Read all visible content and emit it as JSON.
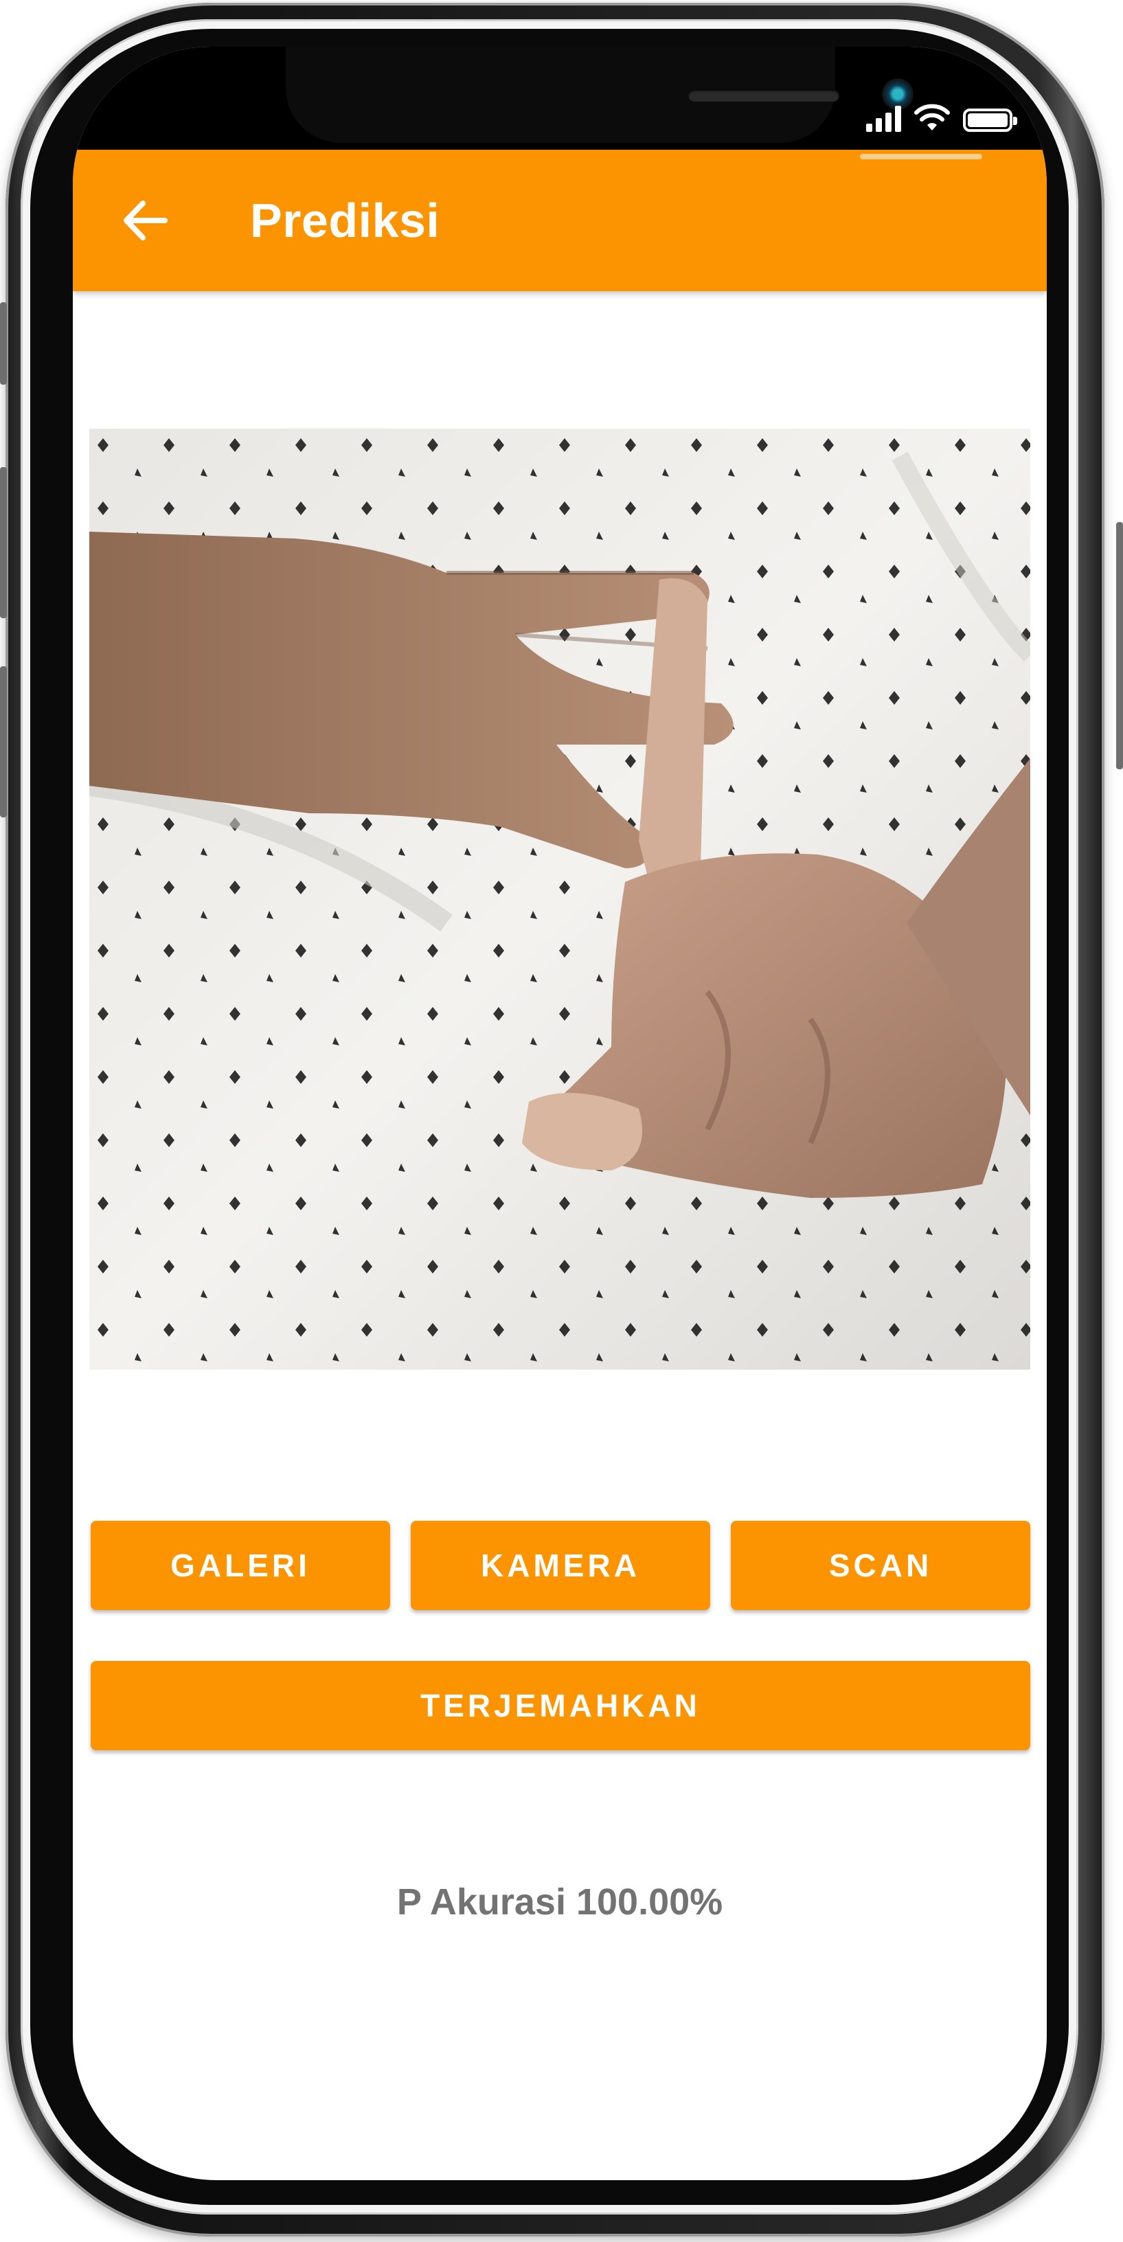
{
  "app_bar": {
    "title": "Prediksi",
    "back_icon": "arrow-left-icon",
    "color": "#fb9400"
  },
  "status_bar": {
    "icons": [
      "signal-icon",
      "wifi-icon",
      "battery-icon"
    ]
  },
  "image": {
    "description_icon": "hand-sign-photo"
  },
  "buttons": {
    "galeri": "GALERI",
    "kamera": "KAMERA",
    "scan": "SCAN",
    "terjemahkan": "TERJEMAHKAN"
  },
  "result": {
    "text": "P Akurasi 100.00%"
  },
  "colors": {
    "accent": "#fb9400",
    "result_text": "#737373"
  }
}
